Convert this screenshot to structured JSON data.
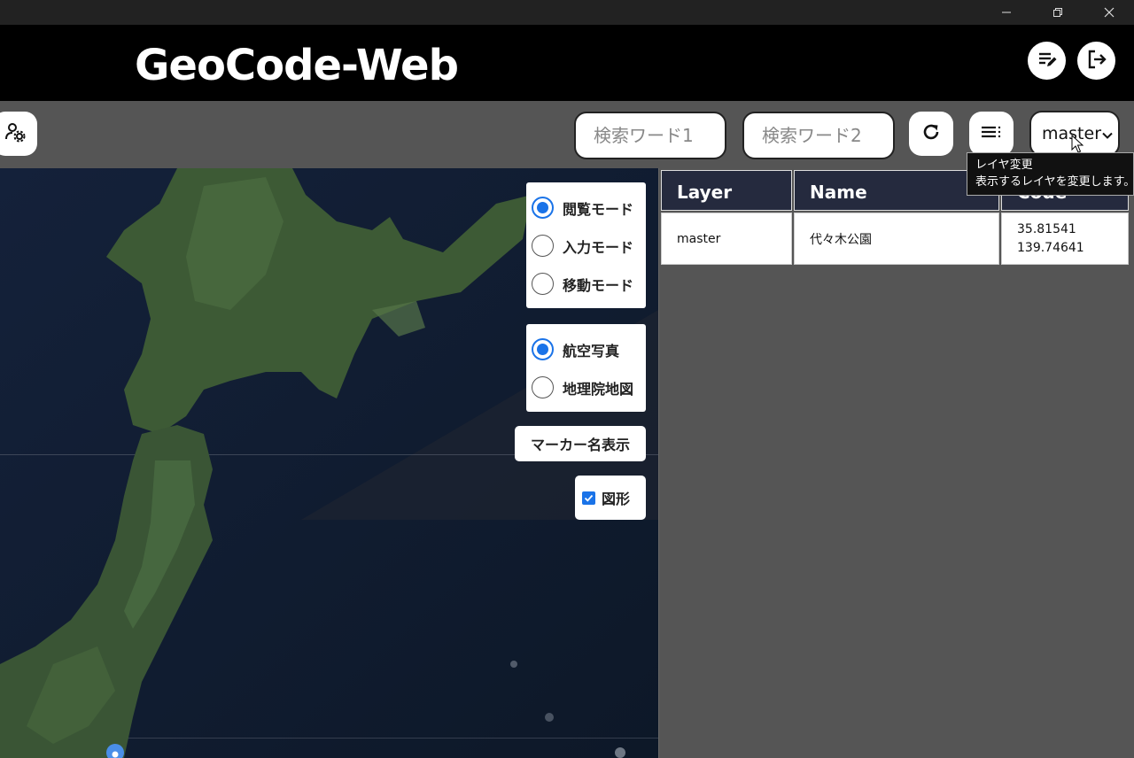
{
  "header": {
    "title": "GeoCode-Web"
  },
  "toolbar": {
    "search1_placeholder": "検索ワード1",
    "search2_placeholder": "検索ワード2",
    "layer_value": "master"
  },
  "tooltip": {
    "line1": "レイヤ変更",
    "line2": "表示するレイヤを変更します。"
  },
  "map": {
    "modes": [
      {
        "label": "閲覧モード",
        "selected": true
      },
      {
        "label": "入力モード",
        "selected": false
      },
      {
        "label": "移動モード",
        "selected": false
      }
    ],
    "basemaps": [
      {
        "label": "航空写真",
        "selected": true
      },
      {
        "label": "地理院地図",
        "selected": false
      }
    ],
    "marker_button": "マーカー名表示",
    "shape_label": "図形",
    "shape_checked": true
  },
  "table": {
    "headers": [
      "Layer",
      "Name",
      "Code"
    ],
    "rows": [
      {
        "layer": "master",
        "name": "代々木公園",
        "lat": "35.81541",
        "lng": "139.74641"
      }
    ]
  },
  "colors": {
    "header_bg": "#000000",
    "accent": "#1a73e8",
    "table_header_bg": "#252a3e"
  },
  "icons": [
    "settings-user-icon",
    "edit-list-icon",
    "logout-icon",
    "refresh-icon",
    "list-menu-icon",
    "chevron-down-icon",
    "minimize-icon",
    "restore-icon",
    "close-icon",
    "cursor-icon"
  ]
}
